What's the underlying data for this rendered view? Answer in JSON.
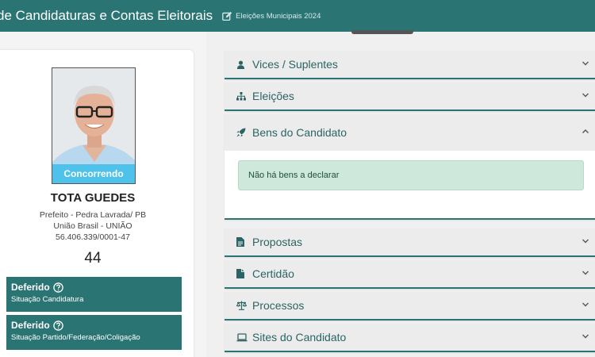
{
  "header": {
    "title": "de Candidaturas e Contas Eleitorais",
    "subtitle": "Eleições Municipais 2024",
    "edit_icon": "edit-icon"
  },
  "candidate": {
    "status_label": "Concorrendo",
    "name": "TOTA GUEDES",
    "office": "Prefeito - Pedra Lavrada/ PB",
    "party": "União Brasil - UNIÃO",
    "cnpj": "56.406.339/0001-47",
    "number": "44",
    "situations": [
      {
        "title": "Deferido",
        "description": "Situação Candidatura"
      },
      {
        "title": "Deferido",
        "description": "Situação Partido/Federação/Coligação"
      }
    ]
  },
  "sections": [
    {
      "label": "Vices / Suplentes",
      "icon": "user-icon",
      "expanded": false
    },
    {
      "label": "Eleições",
      "icon": "sitemap-icon",
      "expanded": false
    },
    {
      "label": "Bens do Candidato",
      "icon": "rocket-icon",
      "expanded": true,
      "message": "Não há bens a declarar"
    },
    {
      "label": "Propostas",
      "icon": "file-icon",
      "expanded": false
    },
    {
      "label": "Certidão",
      "icon": "document-icon",
      "expanded": false
    },
    {
      "label": "Processos",
      "icon": "scale-icon",
      "expanded": false
    },
    {
      "label": "Sites do Candidato",
      "icon": "laptop-icon",
      "expanded": false
    }
  ],
  "colors": {
    "primary": "#2b7474",
    "status": "#4ec2ea",
    "alert_bg": "#cfe8dc"
  }
}
